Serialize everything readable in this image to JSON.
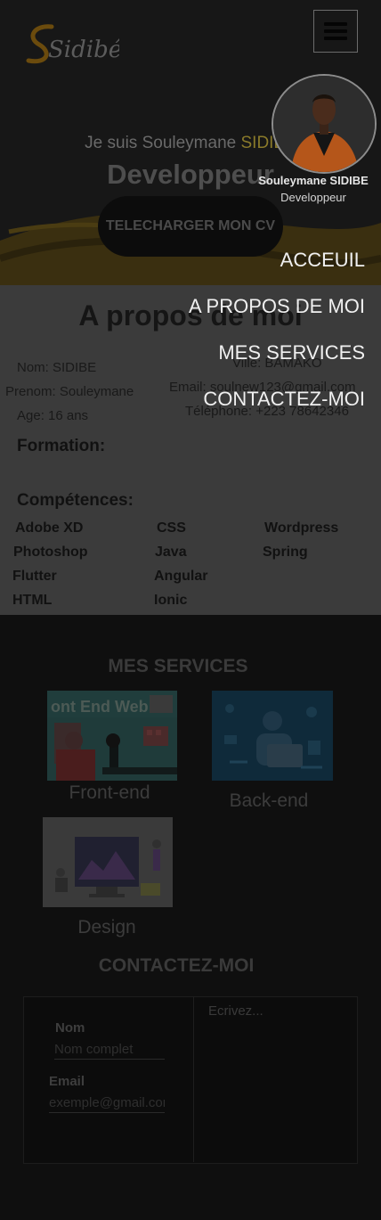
{
  "logo": {
    "text": "Sidibé",
    "initial": "S"
  },
  "hero": {
    "intro": "Je suis Souleymane ",
    "intro_highlight": "SIDIBE",
    "role": "Developpeur",
    "cv_button": "TELECHARGER MON CV"
  },
  "about": {
    "title": "A propos de moi",
    "nom": "Nom: SIDIBE",
    "prenom": "Prenom: Souleymane",
    "age": "Age: 16 ans",
    "ville": "Ville: BAMAKO",
    "email": "Email: soulnew123@gmail.com",
    "telephone": "Téléphone: +223 78642346",
    "formation_title": "Formation:",
    "competences_title": "Compétences:",
    "skills": [
      "Adobe XD",
      "CSS",
      "Wordpress",
      "Photoshop",
      "Java",
      "Spring",
      "Flutter",
      "Angular",
      "HTML",
      "Ionic"
    ]
  },
  "services": {
    "title": "MES SERVICES",
    "items": [
      {
        "label": "Front-end",
        "image_text": "ont End Web"
      },
      {
        "label": "Back-end"
      },
      {
        "label": "Design"
      }
    ]
  },
  "contact": {
    "title": "CONTACTEZ-MOI",
    "nom_label": "Nom",
    "nom_placeholder": "Nom complet",
    "email_label": "Email",
    "email_placeholder": "exemple@gmail.com",
    "message_placeholder": "Ecrivez..."
  },
  "menu": {
    "profile_name": "Souleymane SIDIBE",
    "profile_role": "Developpeur",
    "items": [
      "ACCEUIL",
      "A PROPOS DE MOI",
      "MES SERVICES",
      "CONTACTEZ-MOI"
    ]
  },
  "colors": {
    "accent": "#e8a413",
    "overlay_text": "#f0f0f0"
  }
}
